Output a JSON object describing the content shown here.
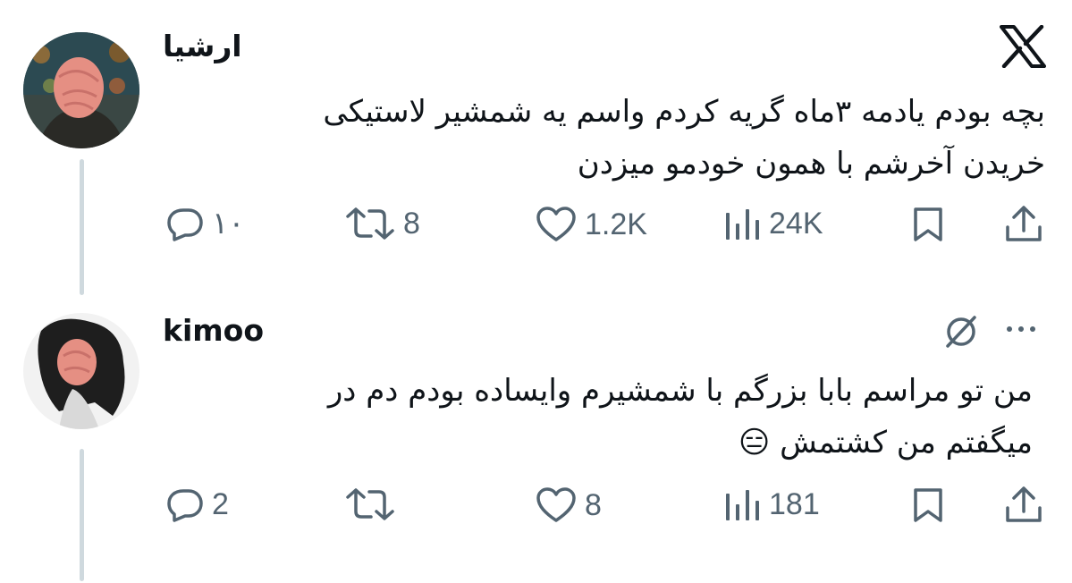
{
  "tweets": [
    {
      "author": "ارشیا",
      "text_lines": [
        "بچه بودم یادمه ۳ماه گریه کردم واسم یه شمشیر  لاستیکی",
        "خریدن آخرشم با همون خودمو میزدن"
      ],
      "replies": "۱۰",
      "retweets": "8",
      "likes": "1.2K",
      "views": "24K"
    },
    {
      "author": "kimoo",
      "text_lines": [
        "من تو مراسم بابا بزرگم با شمشیرم وایساده بودم دم در",
        "میگفتم من کشتمش 😑"
      ],
      "replies": "2",
      "retweets": "",
      "likes": "8",
      "views": "181"
    }
  ],
  "icons": {
    "brand": "x-logo",
    "reply": "speech-bubble-icon",
    "retweet": "retweet-arrows-icon",
    "like": "heart-icon",
    "views": "bar-chart-icon",
    "bookmark": "bookmark-icon",
    "share": "share-upload-icon",
    "grok": "grok-icon",
    "more": "more-dots-icon"
  },
  "colors": {
    "text": "#0f1419",
    "secondary": "#536471",
    "thread_line": "#cfd9de",
    "background": "#ffffff"
  }
}
